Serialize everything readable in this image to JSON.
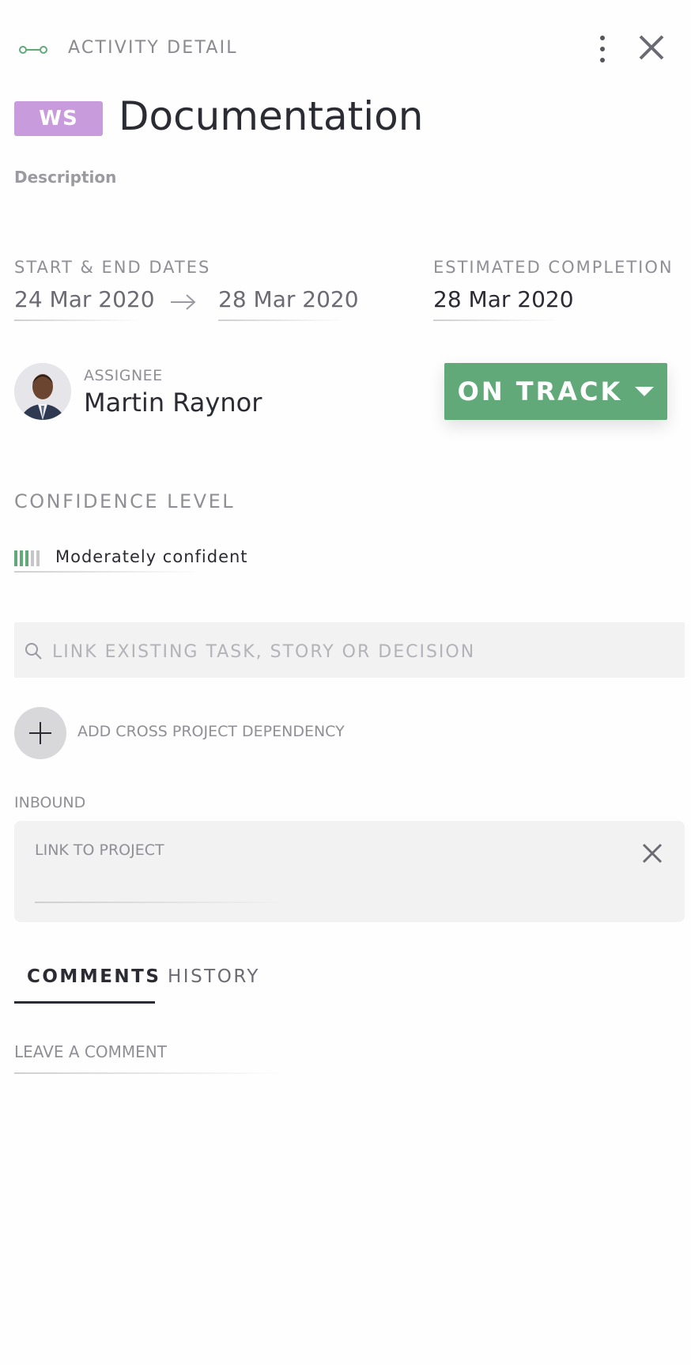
{
  "header": {
    "title": "ACTIVITY DETAIL",
    "icons": [
      "link-icon",
      "more-icon",
      "close-icon"
    ]
  },
  "activity": {
    "badge": "WS",
    "name": "Documentation",
    "description_label": "Description"
  },
  "dates": {
    "label": "START & END DATES",
    "start": "24 Mar 2020",
    "end": "28 Mar 2020",
    "estimated_label": "ESTIMATED COMPLETION",
    "estimated": "28 Mar 2020"
  },
  "assignee": {
    "label": "ASSIGNEE",
    "name": "Martin Raynor"
  },
  "status": {
    "label": "ON TRACK",
    "color": "#62a97a"
  },
  "confidence": {
    "label": "CONFIDENCE LEVEL",
    "value": "Moderately confident",
    "level": 3,
    "max": 5
  },
  "search": {
    "placeholder": "LINK EXISTING TASK, STORY OR DECISION"
  },
  "dependency": {
    "add_label": "ADD CROSS PROJECT DEPENDENCY",
    "inbound_label": "INBOUND",
    "link_label": "LINK TO PROJECT"
  },
  "tabs": [
    {
      "label": "COMMENTS",
      "active": true
    },
    {
      "label": "HISTORY",
      "active": false
    }
  ],
  "comment": {
    "placeholder": "LEAVE A COMMENT"
  },
  "colors": {
    "accent_green": "#62a97a",
    "badge_purple": "#c89bdc"
  }
}
